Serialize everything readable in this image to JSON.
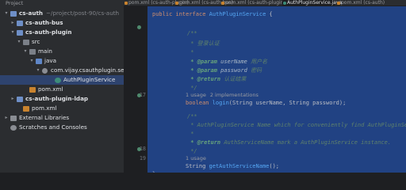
{
  "project": {
    "header": "Project",
    "tree": [
      {
        "label": "cs-auth",
        "path": "~/project/post-90/cs-auth",
        "bold": true,
        "icon": "module-folder-icon",
        "arrow": "v"
      },
      {
        "label": "cs-auth-bus",
        "bold": true,
        "icon": "module-folder-icon",
        "arrow": ">"
      },
      {
        "label": "cs-auth-plugin",
        "bold": true,
        "icon": "module-folder-icon",
        "arrow": "v"
      },
      {
        "label": "src",
        "icon": "folder-icon",
        "arrow": "v"
      },
      {
        "label": "main",
        "icon": "folder-icon",
        "arrow": "v"
      },
      {
        "label": "java",
        "icon": "source-folder-icon",
        "arrow": "v"
      },
      {
        "label": "com.vijay.csauthplugin.servic",
        "icon": "package-icon",
        "arrow": "v"
      },
      {
        "label": "AuthPluginService",
        "icon": "interface-icon",
        "arrow": ""
      },
      {
        "label": "pom.xml",
        "icon": "maven-icon",
        "arrow": ""
      },
      {
        "label": "cs-auth-plugin-ldap",
        "bold": true,
        "icon": "module-folder-icon",
        "arrow": ">"
      },
      {
        "label": "pom.xml",
        "icon": "maven-icon",
        "arrow": ""
      },
      {
        "label": "External Libraries",
        "icon": "library-icon",
        "arrow": ">"
      },
      {
        "label": "Scratches and Consoles",
        "icon": "scratch-icon",
        "arrow": ""
      }
    ]
  },
  "tabs": [
    {
      "label": "pom.xml (cs-auth-plugin)",
      "active": false
    },
    {
      "label": "pom.xml (cs-auth-bus)",
      "active": false
    },
    {
      "label": "pom.xml (cs-auth-plugin-ldap)",
      "active": false
    },
    {
      "label": "AuthPluginService.java",
      "active": true
    },
    {
      "label": "pom.xml (cs-auth)",
      "active": false
    }
  ],
  "editor": {
    "line_numbers": [
      "",
      "",
      "",
      "",
      "",
      "",
      "",
      "",
      "",
      "",
      "17",
      "",
      "",
      "",
      "",
      "",
      "",
      "",
      "18",
      "19"
    ],
    "hints": {
      "usages": "1 usage",
      "implementations": "2 implementations"
    },
    "code": {
      "interface_kw": "public interface ",
      "interface_name": "AuthPluginService",
      "brace_open": " {",
      "doc_open": "/**",
      "doc_login_desc": " * 登录认证",
      "doc_star": " *",
      "doc_param1_tag": " * @param ",
      "doc_param1_name": "userName",
      "doc_param1_desc": " 用户名",
      "doc_param2_tag": " * @param ",
      "doc_param2_name": "password",
      "doc_param2_desc": " 密码",
      "doc_return_tag": " * @return ",
      "doc_return_desc": "认证结果",
      "doc_close": " */",
      "login_type": "boolean ",
      "login_name": "login",
      "login_params": "(String userName, String password);",
      "doc2_line1": " * AuthPluginService Name which for conveniently find AuthPluginService instance.",
      "doc2_return_tag": " * @return ",
      "doc2_return_desc": "AuthServiceName mark a AuthPluginService instance.",
      "name_type": "String ",
      "name_fn": "getAuthServiceName",
      "name_params": "();",
      "brace_close": "}"
    }
  }
}
